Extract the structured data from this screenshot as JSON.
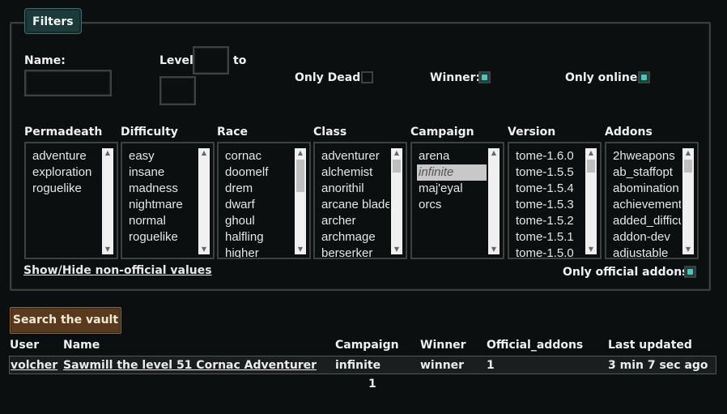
{
  "filters": {
    "legend": "Filters",
    "name_label": "Name:",
    "name_value": "",
    "level_label": "Level:",
    "level_to": "to",
    "level_min": "",
    "level_max": "",
    "only_dead_label": "Only Dead:",
    "only_dead_checked": false,
    "winner_label": "Winner:",
    "winner_checked": true,
    "only_online_label": "Only online:",
    "only_online_checked": true,
    "show_hide_label": "Show/Hide non-official values",
    "only_official_addons_label": "Only official addons:",
    "only_official_addons_checked": true,
    "lists": [
      {
        "header": "Permadeath",
        "items": [
          "adventure",
          "exploration",
          "roguelike"
        ],
        "selected": -1,
        "thumb": "none"
      },
      {
        "header": "Difficulty",
        "items": [
          "easy",
          "insane",
          "madness",
          "nightmare",
          "normal",
          "roguelike"
        ],
        "selected": -1,
        "thumb": "none"
      },
      {
        "header": "Race",
        "items": [
          "cornac",
          "doomelf",
          "drem",
          "dwarf",
          "ghoul",
          "halfling",
          "higher"
        ],
        "selected": -1,
        "thumb": "top"
      },
      {
        "header": "Class",
        "items": [
          "adventurer",
          "alchemist",
          "anorithil",
          "arcane blade",
          "archer",
          "archmage",
          "berserker"
        ],
        "selected": -1,
        "thumb": "top-small"
      },
      {
        "header": "Campaign",
        "items": [
          "arena",
          "infinite",
          "maj'eyal",
          "orcs"
        ],
        "selected": 1,
        "thumb": "none"
      },
      {
        "header": "Version",
        "items": [
          "tome-1.6.0",
          "tome-1.5.5",
          "tome-1.5.4",
          "tome-1.5.3",
          "tome-1.5.2",
          "tome-1.5.1",
          "tome-1.5.0"
        ],
        "selected": -1,
        "thumb": "top-small"
      },
      {
        "header": "Addons",
        "items": [
          "2hweapons",
          "ab_staffopt",
          "abomination",
          "achievement",
          "added_difficulty",
          "addon-dev",
          "adjustable"
        ],
        "selected": -1,
        "thumb": "top-small"
      }
    ]
  },
  "search_button": "Search the vault",
  "results": {
    "headers": [
      "User",
      "Name",
      "Campaign",
      "Winner",
      "Official_addons",
      "Last updated"
    ],
    "rows": [
      {
        "user": "volcher",
        "name": "Sawmill the level 51 Cornac Adventurer",
        "campaign": "infinite",
        "winner": "winner",
        "official_addons": "1",
        "last_updated": "3 min 7 sec ago"
      }
    ]
  },
  "pager": {
    "current_page": "1"
  }
}
